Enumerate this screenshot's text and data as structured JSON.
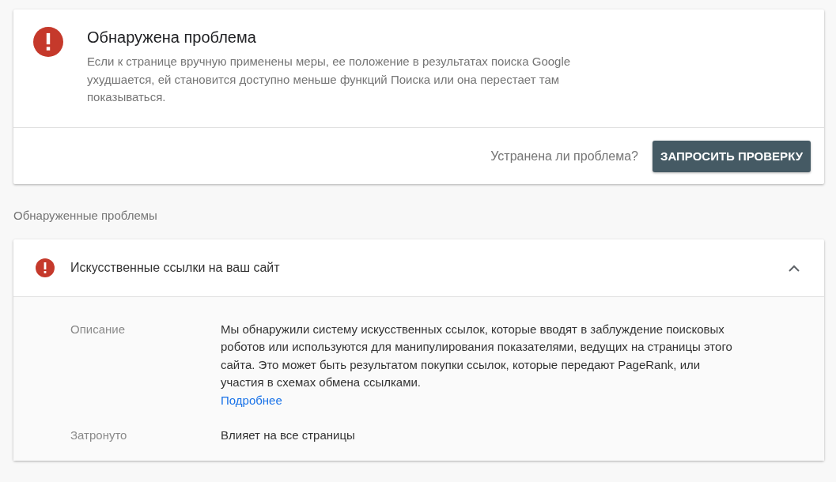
{
  "status_card": {
    "title": "Обнаружена проблема",
    "description": "Если к странице вручную применены меры, ее положение в результатах поиска Google ухудшается, ей становится доступно меньше функций Поиска или она перестает там показываться.",
    "question": "Устранена ли проблема?",
    "button": "ЗАПРОСИТЬ ПРОВЕРКУ"
  },
  "issues_heading": "Обнаруженные проблемы",
  "issues": [
    {
      "title": "Искусственные ссылки на ваш сайт",
      "expanded": true,
      "details": [
        {
          "label": "Описание",
          "text": "Мы обнаружили систему искусственных ссылок, которые вводят в заблуждение поисковых роботов или используются для манипулирования показателями, ведущих на страницы этого сайта. Это может быть результатом покупки ссылок, которые передают PageRank, или участия в схемах обмена ссылками.",
          "link": "Подробнее"
        },
        {
          "label": "Затронуто",
          "text": "Влияет на все страницы"
        }
      ]
    }
  ]
}
